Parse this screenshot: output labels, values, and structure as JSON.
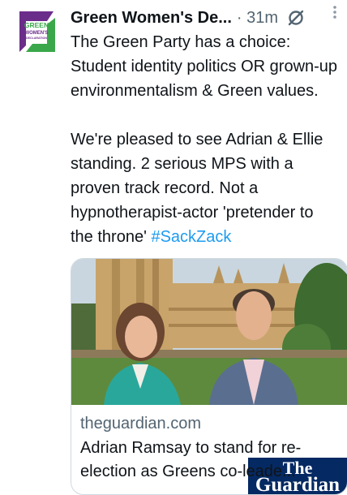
{
  "tweet": {
    "author_name": "Green Women's De...",
    "separator_time": "· 31m",
    "avatar_text": [
      "GREEN",
      "WOMEN'S",
      "DECLARATION"
    ],
    "text": "The Green Party has a choice: Student identity politics OR grown-up environmentalism & Green values.\n\nWe're pleased to see Adrian & Ellie standing. 2 serious MPS with a proven track record. Not a hypnotherapist-actor 'pretender to the throne' ",
    "hashtag": "#SackZack"
  },
  "card": {
    "logo_the": "The",
    "logo_guardian": "Guardian",
    "domain": "theguardian.com",
    "title": "Adrian Ramsay to stand for re-election as Greens co-leade..."
  },
  "icons": {
    "sync": "sync-icon",
    "more": "more-vertical-icon"
  },
  "colors": {
    "brand_purple": "#6b2d8a",
    "brand_green": "#4caf50",
    "link_blue": "#1d9bf0",
    "guardian_navy": "#052962"
  }
}
